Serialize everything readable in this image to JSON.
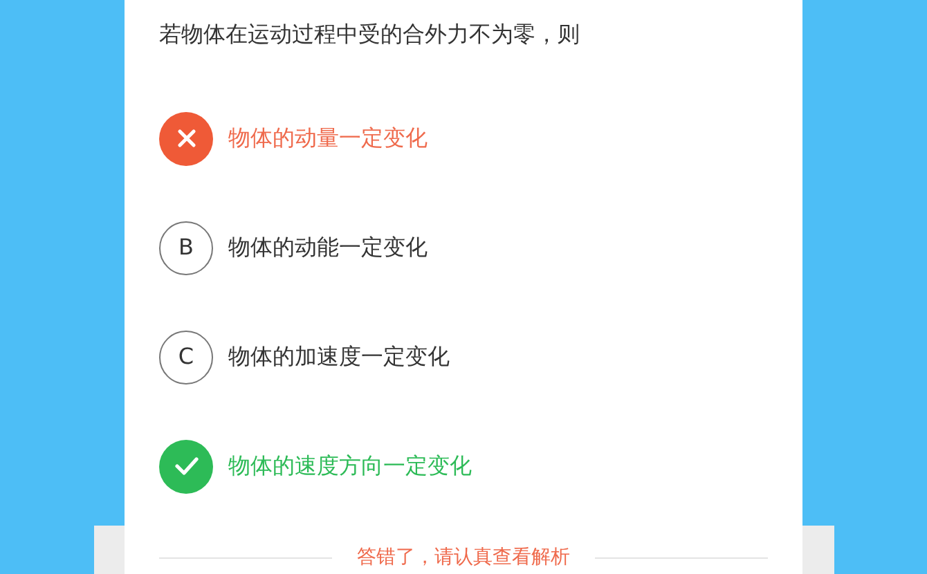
{
  "question": "若物体在运动过程中受的合外力不为零，则",
  "options": [
    {
      "kind": "wrong",
      "text": "物体的动量一定变化"
    },
    {
      "kind": "plain",
      "letter": "B",
      "text": "物体的动能一定变化"
    },
    {
      "kind": "plain",
      "letter": "C",
      "text": "物体的加速度一定变化"
    },
    {
      "kind": "correct",
      "text": "物体的速度方向一定变化"
    }
  ],
  "result": "答错了，请认真查看解析"
}
